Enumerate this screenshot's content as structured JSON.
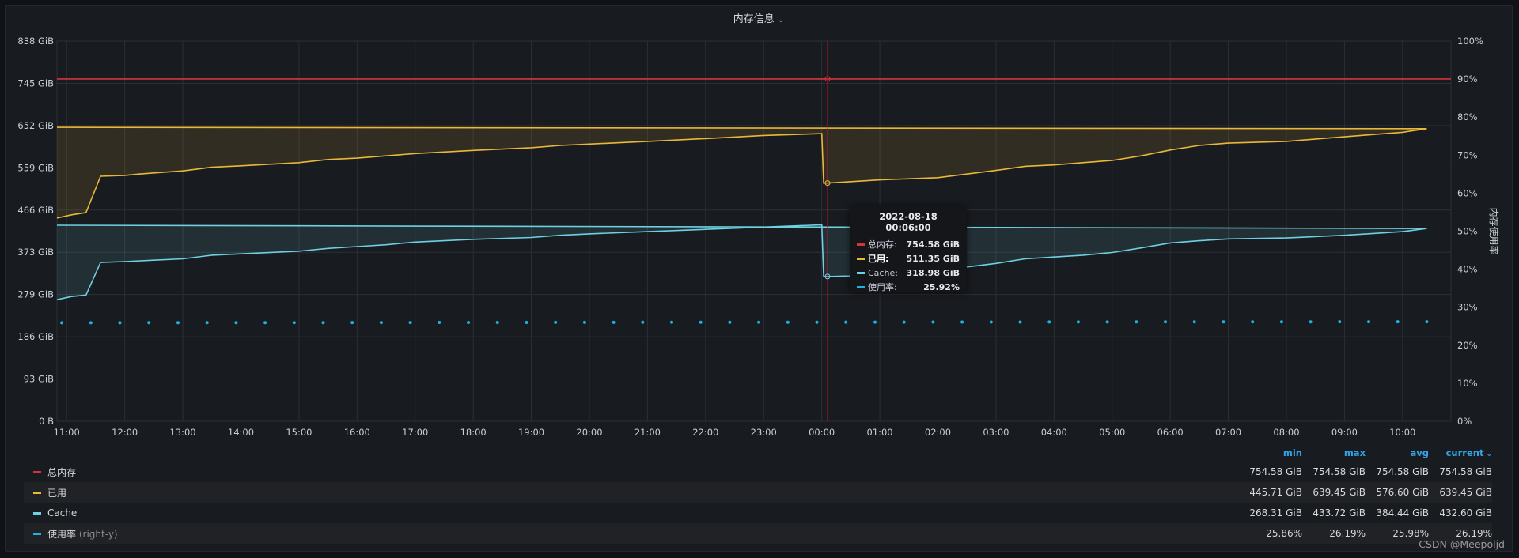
{
  "panel": {
    "title": "内存信息"
  },
  "chart_data": {
    "type": "line",
    "x_range": [
      "10:50",
      "10:50 (+1d)"
    ],
    "x_ticks": [
      "11:00",
      "12:00",
      "13:00",
      "14:00",
      "15:00",
      "16:00",
      "17:00",
      "18:00",
      "19:00",
      "20:00",
      "21:00",
      "22:00",
      "23:00",
      "00:00",
      "01:00",
      "02:00",
      "03:00",
      "04:00",
      "05:00",
      "06:00",
      "07:00",
      "08:00",
      "09:00",
      "10:00"
    ],
    "y_left": {
      "unit": "GiB",
      "min": 0,
      "max": 838,
      "ticks": [
        "0 B",
        "93 GiB",
        "186 GiB",
        "279 GiB",
        "373 GiB",
        "466 GiB",
        "559 GiB",
        "652 GiB",
        "745 GiB",
        "838 GiB"
      ]
    },
    "y_right": {
      "label": "内存使用率",
      "min": 0,
      "max": 100,
      "ticks": [
        "0%",
        "10%",
        "20%",
        "30%",
        "40%",
        "50%",
        "60%",
        "70%",
        "80%",
        "90%",
        "100%"
      ]
    },
    "series": [
      {
        "name": "总内存",
        "color": "#d6333d",
        "axis": "left",
        "fill": false,
        "points": [
          [
            "10:50",
            754.58
          ],
          [
            "10:50 (+1d)",
            754.58
          ]
        ]
      },
      {
        "name": "已用",
        "color": "#eab839",
        "axis": "left",
        "fill": true,
        "points": [
          [
            "10:50",
            448
          ],
          [
            "11:05",
            455
          ],
          [
            "11:20",
            460
          ],
          [
            "11:35",
            540
          ],
          [
            "12:00",
            542
          ],
          [
            "12:15",
            545
          ],
          [
            "13:00",
            552
          ],
          [
            "13:30",
            560
          ],
          [
            "14:00",
            563
          ],
          [
            "15:00",
            570
          ],
          [
            "15:30",
            577
          ],
          [
            "16:00",
            580
          ],
          [
            "16:30",
            585
          ],
          [
            "17:00",
            590
          ],
          [
            "18:00",
            597
          ],
          [
            "19:00",
            603
          ],
          [
            "19:30",
            608
          ],
          [
            "20:00",
            611
          ],
          [
            "21:00",
            617
          ],
          [
            "22:00",
            623
          ],
          [
            "23:00",
            630
          ],
          [
            "00:00",
            634
          ],
          [
            "00:02",
            525
          ],
          [
            "00:06",
            525
          ],
          [
            "01:00",
            532
          ],
          [
            "02:00",
            537
          ],
          [
            "02:30",
            545
          ],
          [
            "03:00",
            553
          ],
          [
            "03:30",
            562
          ],
          [
            "04:00",
            565
          ],
          [
            "04:30",
            570
          ],
          [
            "05:00",
            575
          ],
          [
            "05:30",
            585
          ],
          [
            "06:00",
            598
          ],
          [
            "06:30",
            608
          ],
          [
            "07:00",
            613
          ],
          [
            "08:00",
            617
          ],
          [
            "09:00",
            627
          ],
          [
            "09:30",
            632
          ],
          [
            "10:00",
            637
          ],
          [
            "10:25",
            645
          ],
          [
            "10:50",
            648
          ]
        ]
      },
      {
        "name": "Cache",
        "color": "#6ed0e0",
        "axis": "left",
        "fill": true,
        "points": [
          [
            "10:50",
            268
          ],
          [
            "11:05",
            275
          ],
          [
            "11:20",
            278
          ],
          [
            "11:35",
            350
          ],
          [
            "12:00",
            352
          ],
          [
            "12:30",
            355
          ],
          [
            "13:00",
            358
          ],
          [
            "13:30",
            366
          ],
          [
            "14:00",
            369
          ],
          [
            "15:00",
            375
          ],
          [
            "15:30",
            381
          ],
          [
            "16:00",
            385
          ],
          [
            "16:30",
            389
          ],
          [
            "17:00",
            395
          ],
          [
            "18:00",
            401
          ],
          [
            "19:00",
            405
          ],
          [
            "19:30",
            410
          ],
          [
            "20:00",
            413
          ],
          [
            "21:00",
            418
          ],
          [
            "22:00",
            423
          ],
          [
            "23:00",
            428
          ],
          [
            "00:00",
            433
          ],
          [
            "00:02",
            319
          ],
          [
            "00:06",
            319
          ],
          [
            "01:00",
            322
          ],
          [
            "02:00",
            325
          ],
          [
            "02:30",
            340
          ],
          [
            "03:00",
            348
          ],
          [
            "03:30",
            358
          ],
          [
            "04:00",
            362
          ],
          [
            "04:30",
            366
          ],
          [
            "05:00",
            372
          ],
          [
            "05:30",
            382
          ],
          [
            "06:00",
            393
          ],
          [
            "06:30",
            398
          ],
          [
            "07:00",
            402
          ],
          [
            "08:00",
            404
          ],
          [
            "09:00",
            410
          ],
          [
            "09:30",
            414
          ],
          [
            "10:00",
            418
          ],
          [
            "10:25",
            425
          ],
          [
            "10:50",
            432
          ]
        ]
      },
      {
        "name": "使用率",
        "color": "#1fb2e0",
        "axis": "right",
        "style": "points",
        "points": [
          [
            "10:50",
            25.9
          ],
          [
            "10:50 (+1d)",
            26.19
          ]
        ]
      }
    ],
    "grid": true,
    "hover_time": "00:06"
  },
  "tooltip": {
    "time": "2022-08-18 00:06:00",
    "rows": [
      {
        "name": "总内存:",
        "value": "754.58 GiB",
        "color": "#d6333d"
      },
      {
        "name": "已用:",
        "value": "511.35 GiB",
        "color": "#eab839",
        "bold": true
      },
      {
        "name": "Cache:",
        "value": "318.98 GiB",
        "color": "#6ed0e0"
      },
      {
        "name": "使用率:",
        "value": "25.92%",
        "color": "#1fb2e0"
      }
    ]
  },
  "legend": {
    "headers": {
      "min": "min",
      "max": "max",
      "avg": "avg",
      "current": "current"
    },
    "rows": [
      {
        "name": "总内存",
        "color": "#d6333d",
        "min": "754.58 GiB",
        "max": "754.58 GiB",
        "avg": "754.58 GiB",
        "current": "754.58 GiB"
      },
      {
        "name": "已用",
        "color": "#eab839",
        "min": "445.71 GiB",
        "max": "639.45 GiB",
        "avg": "576.60 GiB",
        "current": "639.45 GiB"
      },
      {
        "name": "Cache",
        "color": "#6ed0e0",
        "min": "268.31 GiB",
        "max": "433.72 GiB",
        "avg": "384.44 GiB",
        "current": "432.60 GiB"
      },
      {
        "name": "使用率",
        "axis_tag": "(right-y)",
        "color": "#1fb2e0",
        "min": "25.86%",
        "max": "26.19%",
        "avg": "25.98%",
        "current": "26.19%"
      }
    ]
  },
  "watermark": "CSDN @Meepoljd"
}
